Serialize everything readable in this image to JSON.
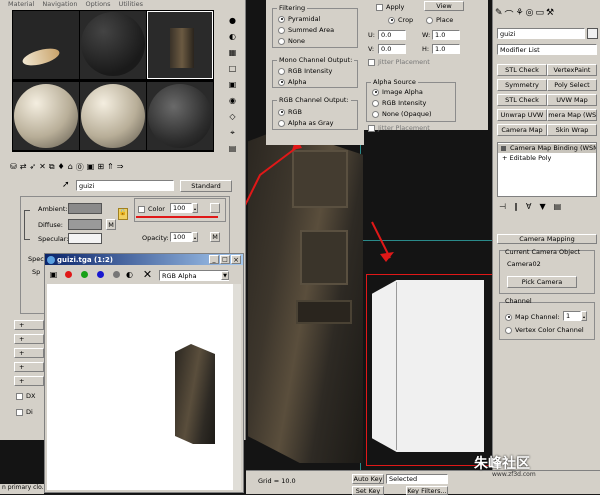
{
  "mat_editor": {
    "menu": [
      "Material",
      "Navigation",
      "Options",
      "Utilities"
    ],
    "mat_name": "guizi",
    "mat_type": "Standard",
    "ambient_label": "Ambient:",
    "diffuse_label": "Diffuse:",
    "specular_label": "Specular:",
    "m_label": "M",
    "self_illum_color_label": "Color",
    "self_illum_value": "100",
    "opacity_label": "Opacity:",
    "opacity_value": "100",
    "spec_label": "Spec",
    "sp_label": "Sp",
    "plus": "+",
    "dx_label": "DX",
    "di_label": "Di"
  },
  "bitmap_win": {
    "title": "guizi.tga (1:2)",
    "channel": "RGB Alpha",
    "close": "×"
  },
  "filter_panel": {
    "filtering_title": "Filtering",
    "filters": [
      "Pyramidal",
      "Summed Area",
      "None"
    ],
    "mono_title": "Mono Channel Output:",
    "mono": [
      "RGB Intensity",
      "Alpha"
    ],
    "rgb_title": "RGB Channel Output:",
    "rgb": [
      "RGB",
      "Alpha as Gray"
    ]
  },
  "crop_panel": {
    "apply": "Apply",
    "view": "View",
    "crop": "Crop",
    "place": "Place",
    "u_label": "U:",
    "u_value": "0.0",
    "v_label": "V:",
    "v_value": "0.0",
    "w_label": "W:",
    "w_value": "1.0",
    "h_label": "H:",
    "h_value": "1.0",
    "jitter1": "Jitter Placement",
    "alpha_source_title": "Alpha Source",
    "alpha_sources": [
      "Image Alpha",
      "RGB Intensity",
      "None (Opaque)"
    ],
    "jitter2": "Jitter Placement"
  },
  "command_panel": {
    "object_name": "guizi",
    "modifier_list": "Modifier List",
    "buttons": [
      "STL Check",
      "VertexPaint",
      "Symmetry",
      "Poly Select",
      "STL Check",
      "UVW Map",
      "Unwrap UVW",
      "Camera Map (WSM)",
      "Camera Map",
      "Skin Wrap"
    ],
    "stack": [
      "Camera Map Binding (WSM)",
      "Editable Poly"
    ],
    "rollout_title": "Camera Mapping",
    "current_camera_label": "Current Camera Object",
    "camera_name": "Camera02",
    "pick_camera": "Pick Camera",
    "channel_title": "Channel",
    "map_channel_label": "Map Channel:",
    "map_channel_value": "1",
    "vertex_color_channel": "Vertex Color Channel"
  },
  "status": {
    "grid": "Grid = 10.0",
    "auto_key": "Auto Key",
    "selected": "Selected",
    "set_key": "Set Key",
    "key_filters": "Key Filters...",
    "watermark_text": "朱峰社区",
    "watermark_url": "www.zf3d.com",
    "left_status": "n primary clo..."
  },
  "colors": {
    "ui_gray": "#d4d0c8",
    "annotation_red": "#e01818",
    "viewport_bg": "#1a1a1a"
  }
}
